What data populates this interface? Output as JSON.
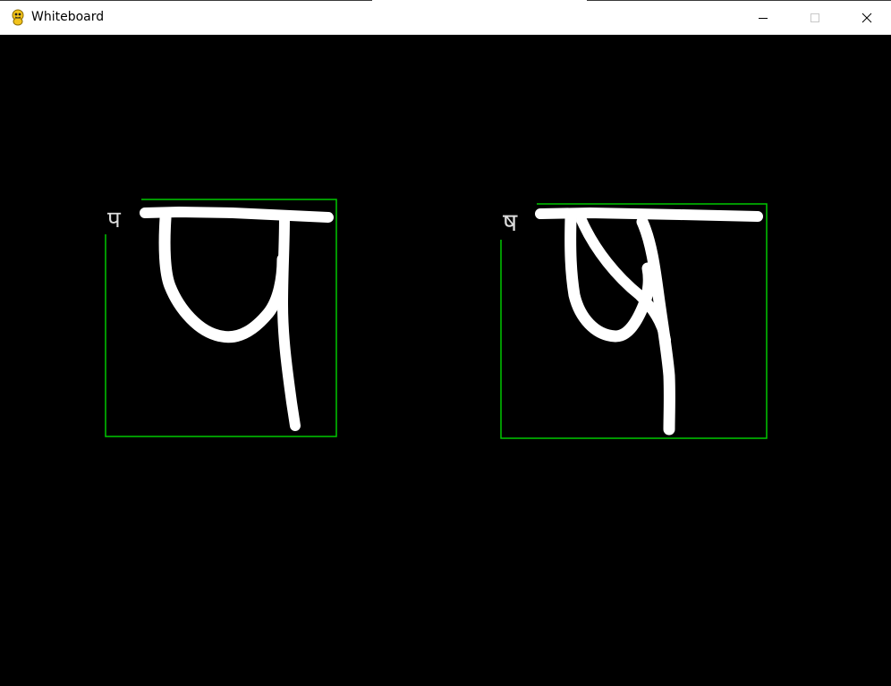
{
  "window": {
    "title": "Whiteboard",
    "app_icon": "pygame-snake-icon",
    "controls": [
      "minimize-icon",
      "maximize-icon",
      "close-icon"
    ]
  },
  "canvas": {
    "background": "#000000",
    "stroke_color": "#ffffff",
    "box_color": "#00c800",
    "drawings": [
      {
        "prediction": "प"
      },
      {
        "prediction": "ष"
      }
    ]
  }
}
